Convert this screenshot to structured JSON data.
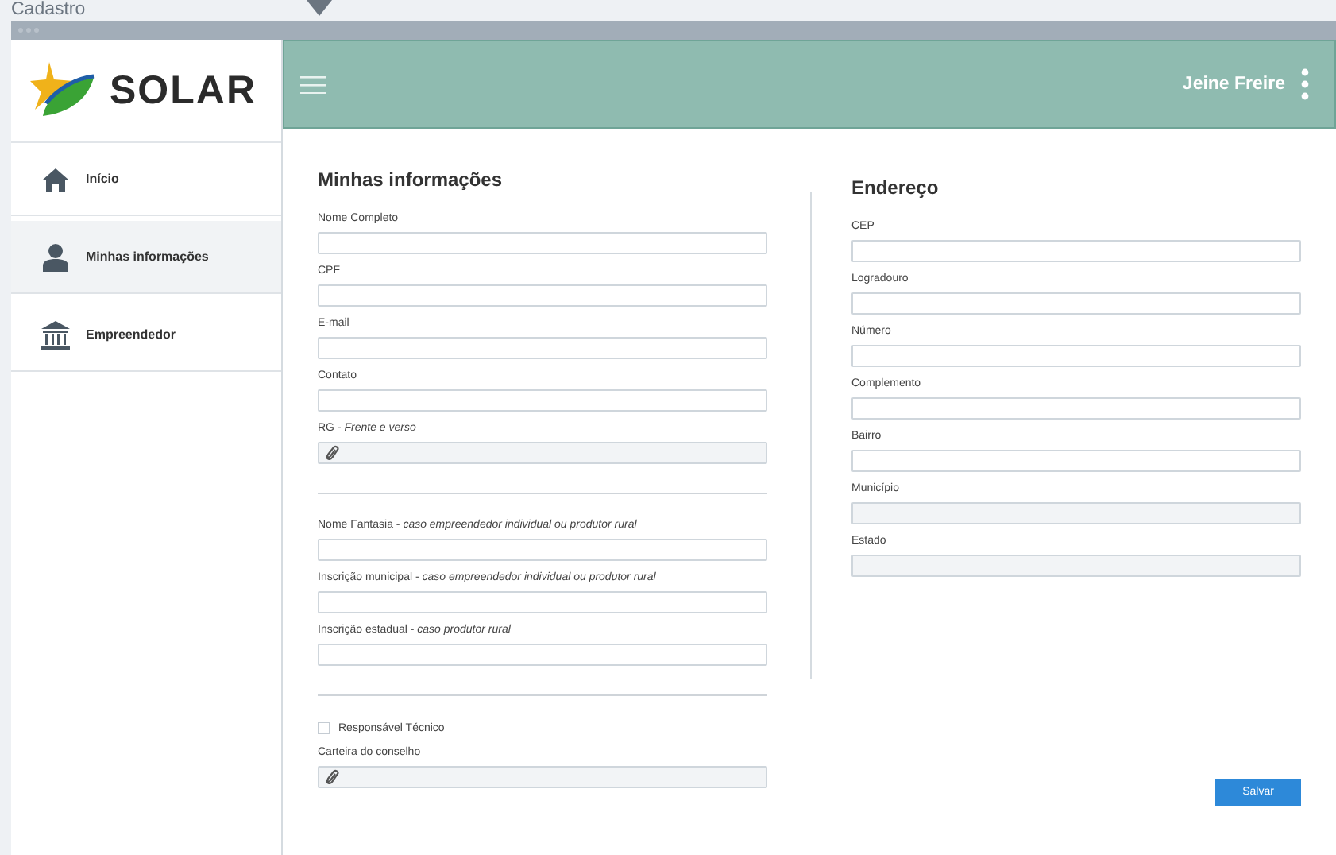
{
  "page_title": "Cadastro",
  "logo": {
    "text": "SOLAR"
  },
  "sidebar": {
    "items": [
      {
        "label": "Início",
        "kind": "home",
        "selected": false
      },
      {
        "label": "Minhas informações",
        "kind": "user",
        "selected": true
      },
      {
        "label": "Empreendedor",
        "kind": "bank",
        "selected": false
      }
    ]
  },
  "header": {
    "user_name": "Jeine Freire"
  },
  "sections": [
    {
      "title": "Minhas informações",
      "items": [
        {
          "kind": "text",
          "label": "Nome Completo"
        },
        {
          "kind": "text",
          "label": "CPF"
        },
        {
          "kind": "text",
          "label": "E-mail"
        },
        {
          "kind": "text",
          "label": "Contato"
        },
        {
          "kind": "attach",
          "label": "RG - *Frente e verso*"
        },
        {
          "kind": "rule"
        },
        {
          "kind": "text",
          "label": "Nome Fantasia - *caso empreendedor individual ou produtor rural*"
        },
        {
          "kind": "text",
          "label": "Inscrição municipal - *caso empreendedor individual ou produtor rural*"
        },
        {
          "kind": "text",
          "label": "Inscrição estadual - *caso produtor rural*"
        },
        {
          "kind": "rule"
        },
        {
          "kind": "checkbox",
          "label": "Responsável Técnico",
          "checked": false
        },
        {
          "kind": "attach",
          "label": "Carteira do conselho"
        }
      ]
    },
    {
      "title": "Endereço",
      "items": [
        {
          "kind": "text",
          "label": "CEP"
        },
        {
          "kind": "text",
          "label": "Logradouro"
        },
        {
          "kind": "text",
          "label": "Número"
        },
        {
          "kind": "text",
          "label": "Complemento"
        },
        {
          "kind": "text",
          "label": "Bairro"
        },
        {
          "kind": "disabled",
          "label": "Município"
        },
        {
          "kind": "disabled",
          "label": "Estado"
        }
      ]
    }
  ],
  "save_button": "Salvar"
}
